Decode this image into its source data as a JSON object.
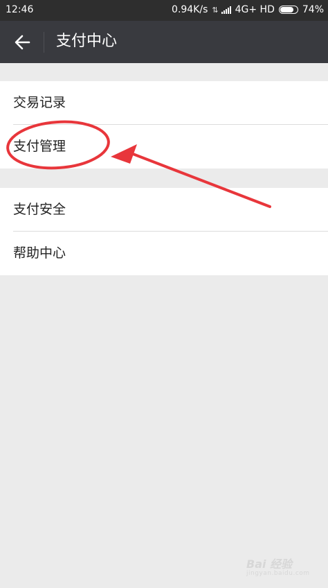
{
  "status_bar": {
    "time": "12:46",
    "speed": "0.94K/s",
    "network": "4G+ HD",
    "battery_text": "74%",
    "battery_level": 0.74
  },
  "header": {
    "title": "支付中心"
  },
  "groups": [
    {
      "items": [
        {
          "label": "交易记录"
        },
        {
          "label": "支付管理"
        }
      ]
    },
    {
      "items": [
        {
          "label": "支付安全"
        },
        {
          "label": "帮助中心"
        }
      ]
    }
  ],
  "annotation_color": "#e8363b",
  "watermark": {
    "brand": "Bai 经验",
    "sub": "jingyan.baidu.com"
  }
}
